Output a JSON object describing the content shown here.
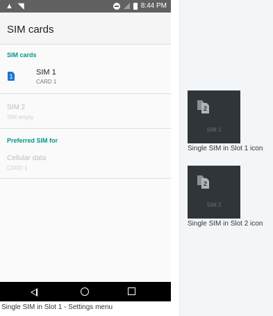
{
  "status_bar": {
    "left_icons": "▲ ◥",
    "time": "8:44 PM"
  },
  "app_bar": {
    "title": "SIM cards"
  },
  "sections": {
    "sim_cards_header": "SIM cards",
    "preferred_header": "Preferred SIM for"
  },
  "sim1": {
    "badge": "1",
    "title": "SIM 1",
    "subtitle": "CARD 1"
  },
  "sim2": {
    "title": "SIM 2",
    "subtitle": "SIM empty"
  },
  "cellular": {
    "title": "Cellular data",
    "subtitle": "CARD 1"
  },
  "nav": {
    "back_icon": "triangle-back-icon",
    "home_icon": "circle-home-icon",
    "recents_icon": "square-recents-icon"
  },
  "captions": {
    "main": "Single SIM in Slot 1 - Settings menu",
    "icon1": "Single SIM in Slot 1 icon",
    "icon2": "Single SIM in Slot 2 icon"
  },
  "icons": {
    "tile1": {
      "glyph": "2",
      "label": "SIM 1"
    },
    "tile2": {
      "glyph": "2",
      "label": "SIM 2"
    }
  },
  "colors": {
    "accent": "#009688",
    "sim_badge": "#1976d2",
    "status_bar": "#616161",
    "icon_tile": "#2f3539"
  }
}
